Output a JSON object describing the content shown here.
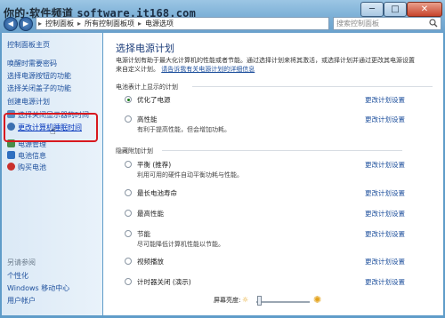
{
  "watermark": {
    "brand": "你的·软件频道",
    "site": "software.it168.com"
  },
  "window": {
    "min_label": "─",
    "max_label": "□",
    "close_label": "✕"
  },
  "address_bar": {
    "crumbs": [
      "▸",
      "控制面板",
      "▸",
      "所有控制面板项",
      "▸",
      "电源选项"
    ]
  },
  "search": {
    "placeholder": "搜索控制面板"
  },
  "nav": {
    "back": "◀",
    "forward": "▶"
  },
  "sidebar": {
    "home": "控制面板主页",
    "items": [
      "唤醒时需要密码",
      "选择电源按钮的功能",
      "选择关闭盖子的功能",
      "创建电源计划",
      "选择关闭显示器的时间",
      "更改计算机睡眠时间"
    ],
    "selected_index": 5,
    "bottom_items": [
      "电源管理",
      "电池信息",
      "购买电池"
    ],
    "see_also_title": "另请参阅",
    "see_also": [
      "个性化",
      "Windows 移动中心",
      "用户帐户"
    ]
  },
  "main": {
    "title": "选择电源计划",
    "description": "电源计划有助于最大化计算机的性能或者节能。通过选择计划来将其激活，或选择计划并通过更改其电源设置来自定义计划。",
    "description_link": "请告诉我有关电源计划的详细信息",
    "section1_title": "电池表计上显示的计划",
    "section2_title": "隐藏附加计划",
    "plans": [
      {
        "name": "优化了电源",
        "desc": "",
        "selected": true,
        "link": "更改计划设置"
      },
      {
        "name": "高性能",
        "desc": "有利于提高性能，但会增加功耗。",
        "selected": false,
        "link": "更改计划设置"
      },
      {
        "name": "平衡 (推荐)",
        "desc": "利用可用的硬件自动平衡功耗与性能。",
        "selected": false,
        "link": "更改计划设置"
      },
      {
        "name": "最长电池寿命",
        "desc": "",
        "selected": false,
        "link": "更改计划设置"
      },
      {
        "name": "最高性能",
        "desc": "",
        "selected": false,
        "link": "更改计划设置"
      },
      {
        "name": "节能",
        "desc": "尽可能降低计算机性能以节能。",
        "selected": false,
        "link": "更改计划设置"
      },
      {
        "name": "视频播放",
        "desc": "",
        "selected": false,
        "link": "更改计划设置"
      },
      {
        "name": "计时器关闭 (演示)",
        "desc": "",
        "selected": false,
        "link": "更改计划设置"
      }
    ],
    "brightness_label": "屏幕亮度:",
    "brightness_level": 0.05
  },
  "colors": {
    "accent": "#1d4f9c",
    "highlight_box": "#d8191f"
  }
}
